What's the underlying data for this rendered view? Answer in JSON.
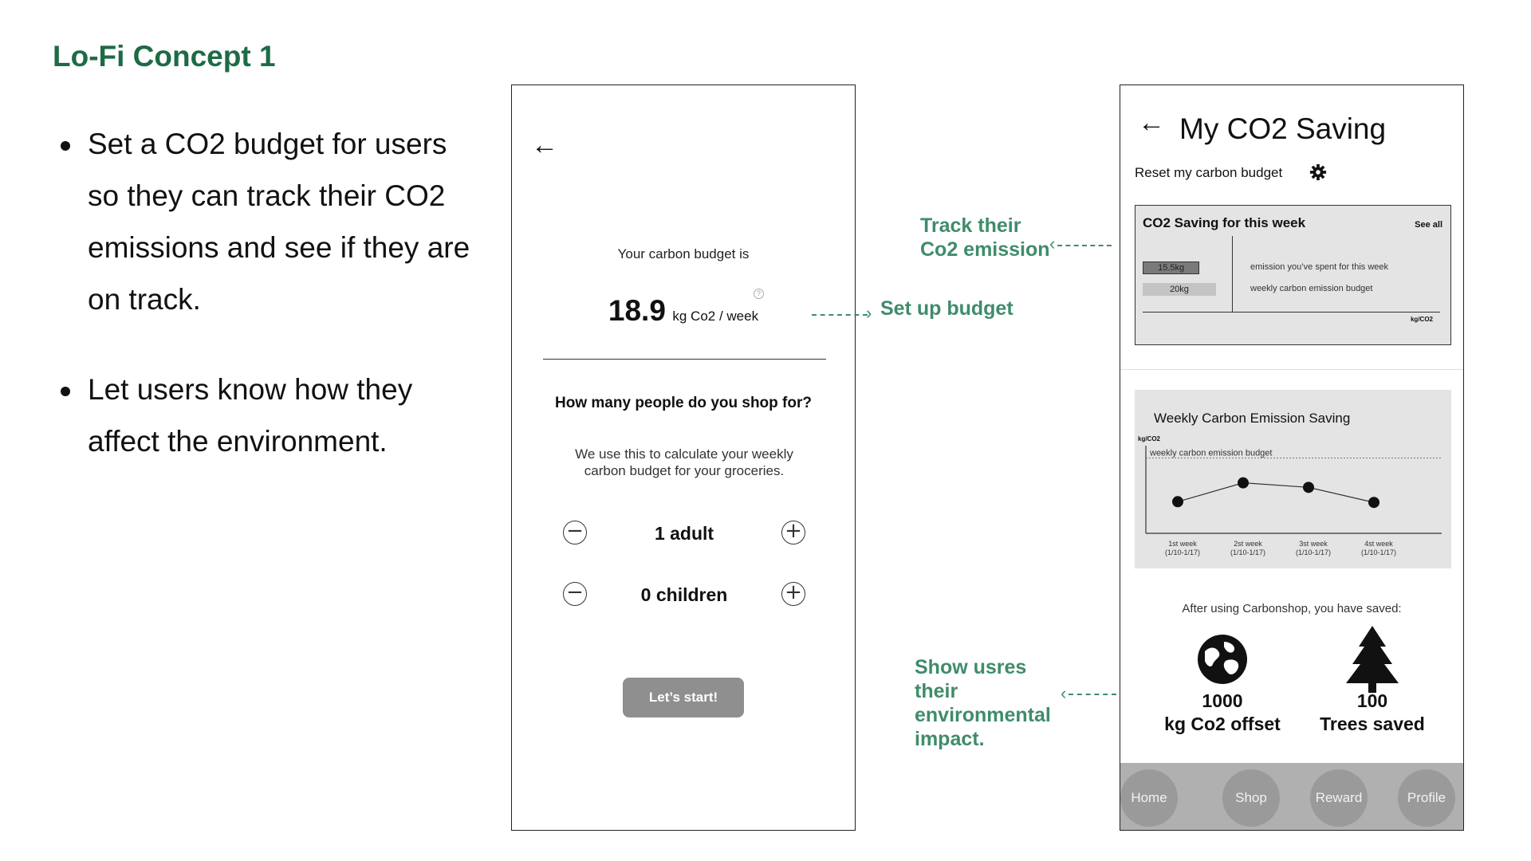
{
  "slide": {
    "title": "Lo-Fi Concept 1",
    "bullets": [
      "Set a CO2 budget for users so they can track their CO2 emissions and see if they are on track.",
      "Let users know how they affect the environment."
    ]
  },
  "screen1": {
    "back_icon": "arrow-left-icon",
    "budget_label": "Your carbon budget is",
    "budget_value": "18.9",
    "budget_unit": "kg Co2 / week",
    "help_icon": "?",
    "question": "How many people do you shop for?",
    "description": "We use this to calculate your weekly carbon budget for your groceries.",
    "counters": [
      {
        "value": "1 adult"
      },
      {
        "value": "0 children"
      }
    ],
    "start_button": "Let’s start!"
  },
  "annotations": {
    "setup": "Set up budget",
    "track": "Track their Co2 emission",
    "impact": "Show usres their environmental impact."
  },
  "screen2": {
    "title": "My CO2 Saving",
    "reset_label": "Reset my carbon budget",
    "weekly_card": {
      "title": "CO2 Saving for this week",
      "see_all": "See all",
      "unit": "kg/CO2",
      "bars": [
        {
          "label": "15.5kg",
          "value": 15.5,
          "legend": "emission you’ve spent for this week"
        },
        {
          "label": "20kg",
          "value": 20,
          "legend": "weekly carbon emission budget"
        }
      ]
    },
    "saving_chart": {
      "title": "Weekly Carbon Emission Saving",
      "ylabel": "kg/CO2",
      "budget_line_label": "weekly carbon emission budget",
      "weeks": [
        {
          "label": "1st week",
          "range": "(1/10-1/17)"
        },
        {
          "label": "2st week",
          "range": "(1/10-1/17)"
        },
        {
          "label": "3st week",
          "range": "(1/10-1/17)"
        },
        {
          "label": "4st week",
          "range": "(1/10-1/17)"
        }
      ]
    },
    "saved_label": "After using Carbonshop, you have saved:",
    "stats": [
      {
        "icon": "globe-icon",
        "value": "1000",
        "label": "kg Co2 offset"
      },
      {
        "icon": "tree-icon",
        "value": "100",
        "label": "Trees saved"
      }
    ],
    "nav": [
      "Home",
      "Shop",
      "Reward",
      "Profile"
    ]
  },
  "chart_data": {
    "type": "line",
    "title": "Weekly Carbon Emission Saving",
    "ylabel": "kg/CO2",
    "categories": [
      "1st week (1/10-1/17)",
      "2st week (1/10-1/17)",
      "3st week (1/10-1/17)",
      "4st week (1/10-1/17)"
    ],
    "series": [
      {
        "values": [
          0.42,
          0.67,
          0.61,
          0.41
        ]
      }
    ],
    "reference_line": {
      "label": "weekly carbon emission budget",
      "value": 1.0
    },
    "ylim": [
      0,
      1.1
    ]
  },
  "colors": {
    "accent": "#3f8c6b",
    "title": "#1d6b45",
    "button": "#8f8f8f"
  }
}
